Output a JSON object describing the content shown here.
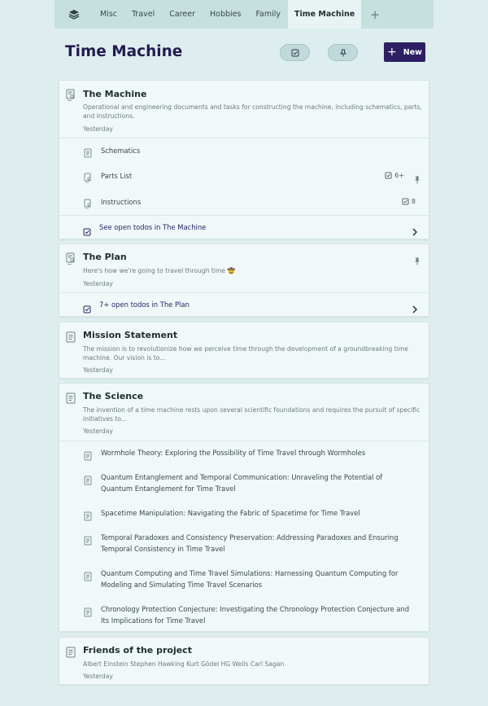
{
  "tabs": [
    "Misc",
    "Travel",
    "Career",
    "Hobbies",
    "Family",
    "Time Machine"
  ],
  "active_tab": "Time Machine",
  "page_title": "Time Machine",
  "new_button_label": "New",
  "cards": {
    "machine": {
      "title": "The Machine",
      "description": "Operational and engineering documents and tasks for constructing the machine, including schematics, parts, and instructions.",
      "date": "Yesterday",
      "children": [
        {
          "label": "Schematics"
        },
        {
          "label": "Parts List",
          "todo_count": "6+"
        },
        {
          "label": "Instructions",
          "todo_count": "8"
        }
      ],
      "todos_label": "See open todos in The Machine"
    },
    "plan": {
      "title": "The Plan",
      "description": "Here's how we're going to travel through time 🤠",
      "date": "Yesterday",
      "todos_label": "7+ open todos in The Plan"
    },
    "mission": {
      "title": "Mission Statement",
      "description": "The mission is to revolutionize how we perceive time through the development of a groundbreaking time machine. Our vision is to...",
      "date": "Yesterday"
    },
    "science": {
      "title": "The Science",
      "description": "The invention of a time machine rests upon several scientific foundations and requires the pursuit of specific initiatives to...",
      "date": "Yesterday",
      "children": [
        "Wormhole Theory: Exploring the Possibility of Time Travel through Wormholes",
        "Quantum Entanglement and Temporal Communication: Unraveling the Potential of Quantum Entanglement for Time Travel",
        "Spacetime Manipulation: Navigating the Fabric of Spacetime for Time Travel",
        "Temporal Paradoxes and Consistency Preservation: Addressing Paradoxes and Ensuring Temporal Consistency in Time Travel",
        "Quantum Computing and Time Travel Simulations: Harnessing Quantum Computing for Modeling and Simulating Time Travel Scenarios",
        "Chronology Protection Conjecture: Investigating the Chronology Protection Conjecture and Its Implications for Time Travel"
      ]
    },
    "friends": {
      "title": "Friends of the project",
      "description": "Albert Einstein Stephen Hawking Kurt Gödel HG Wells Carl Sagan",
      "date": "Yesterday"
    }
  },
  "colors": {
    "background": "#deeeee",
    "tabbar": "#c6e0e0",
    "accent": "#2d1f63",
    "card": "#f1f8f8"
  }
}
